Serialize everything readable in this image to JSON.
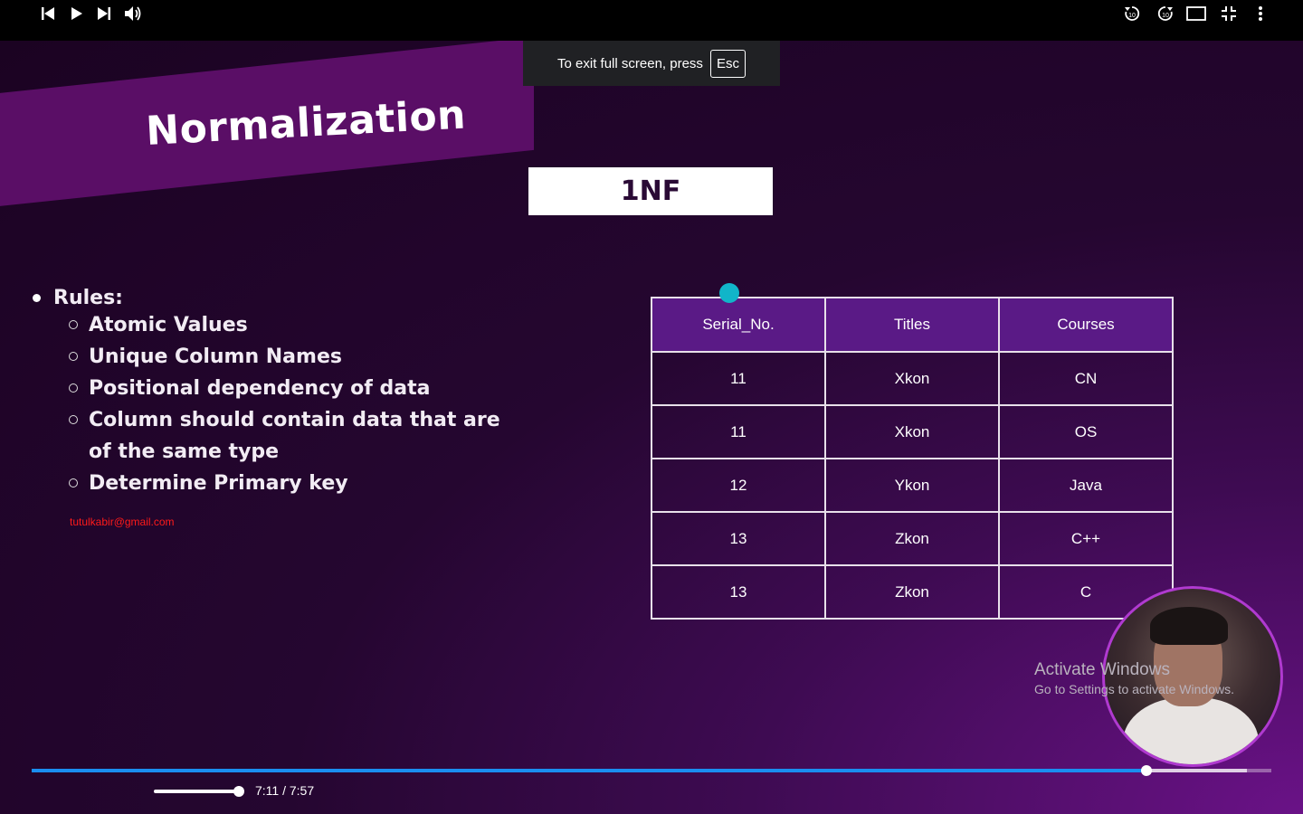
{
  "slide": {
    "title": "Normalization",
    "subtitle_box": "1NF",
    "rules_heading": "Rules:",
    "rules": [
      "Atomic Values",
      "Unique Column Names",
      "Positional dependency of data",
      "Column should contain data that are of the same type",
      "Determine Primary key"
    ],
    "email": "tutulkabir@gmail.com",
    "table": {
      "headers": [
        "Serial_No.",
        "Titles",
        "Courses"
      ],
      "rows": [
        [
          "11",
          "Xkon",
          "CN"
        ],
        [
          "11",
          "Xkon",
          "OS"
        ],
        [
          "12",
          "Ykon",
          "Java"
        ],
        [
          "13",
          "Zkon",
          "C++"
        ],
        [
          "13",
          "Zkon",
          "C"
        ]
      ]
    }
  },
  "watermark": {
    "line1": "Activate Windows",
    "line2": "Go to Settings to activate Windows."
  },
  "fullscreen_toast": {
    "message": "To exit full screen, press",
    "key": "Esc"
  },
  "player": {
    "current_time": "7:11",
    "duration": "7:57",
    "time_display": "7:11 / 7:57",
    "progress_fraction": 0.899,
    "buffered_fraction": 0.98,
    "volume_fraction": 0.94,
    "accent_color": "#1a8ef0",
    "icons": [
      "previous-icon",
      "play-icon",
      "next-icon",
      "volume-icon",
      "rewind-10-icon",
      "forward-10-icon",
      "theater-mode-icon",
      "exit-fullscreen-icon",
      "more-options-icon"
    ]
  }
}
